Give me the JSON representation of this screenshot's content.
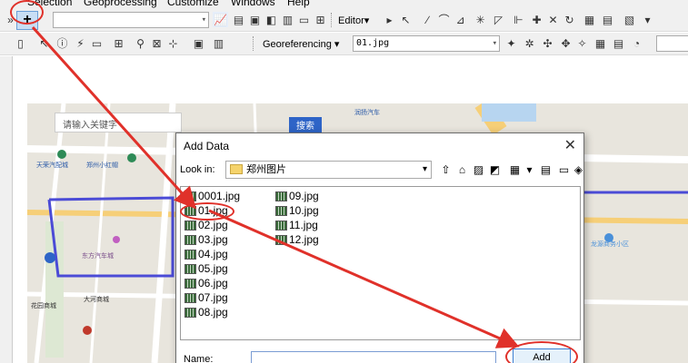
{
  "menubar": {
    "items": [
      "Selection",
      "Geoprocessing",
      "Customize",
      "Windows",
      "Help"
    ]
  },
  "toolbar1": {
    "add_data_label": "+",
    "editor_label": "Editor▾"
  },
  "toolbar2": {
    "georef_label": "Georeferencing ▾",
    "layer_value": "01.jpg"
  },
  "map": {
    "search_placeholder": "请输入关键字",
    "search_button": "搜索",
    "labels": [
      "天荣汽配城",
      "郑州小红帽",
      "润扬汽车",
      "东方汽车城",
      "大河商城",
      "花园商城",
      "龙源商务小区"
    ]
  },
  "dialog": {
    "title": "Add Data",
    "close": "✕",
    "lookin_label": "Look in:",
    "lookin_value": "郑州图片",
    "files_col1": [
      "0001.jpg",
      "01.jpg",
      "02.jpg",
      "03.jpg",
      "04.jpg",
      "05.jpg",
      "06.jpg",
      "07.jpg",
      "08.jpg"
    ],
    "files_col2": [
      "09.jpg",
      "10.jpg",
      "11.jpg",
      "12.jpg"
    ],
    "name_label": "Name:",
    "name_value": "",
    "add_button": "Add"
  },
  "colors": {
    "annotation": "#e0312a",
    "road_outline": "#4b4bd6",
    "map_bg": "#e8e5dd"
  }
}
